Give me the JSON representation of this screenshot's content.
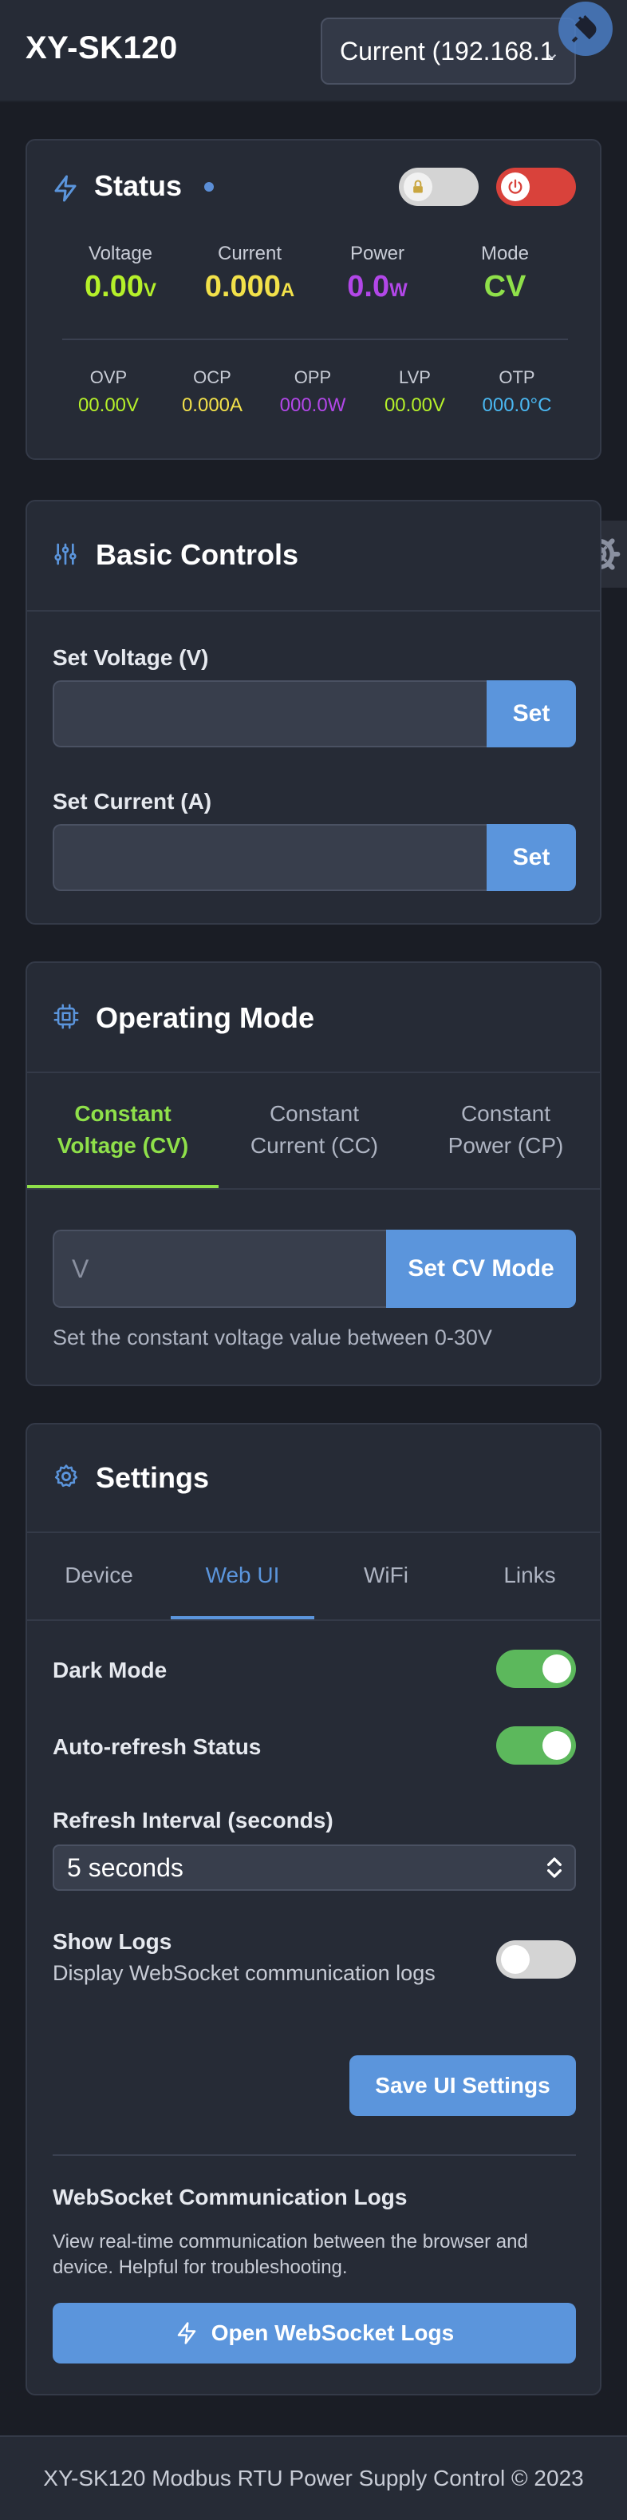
{
  "header": {
    "title": "XY-SK120",
    "device_select_value": "Current (192.168.1",
    "connect_icon": "plug-icon"
  },
  "status": {
    "title": "Status",
    "metrics": [
      {
        "label": "Voltage",
        "value": "0.00",
        "unit": "V",
        "color": "#b5f02a"
      },
      {
        "label": "Current",
        "value": "0.000",
        "unit": "A",
        "color": "#f2e14a"
      },
      {
        "label": "Power",
        "value": "0.0",
        "unit": "W",
        "color": "#b247e8"
      },
      {
        "label": "Mode",
        "value": "CV",
        "unit": "",
        "color": "#8fe04a"
      }
    ],
    "protections": [
      {
        "label": "OVP",
        "value": "00.00V",
        "color": "#b5f02a"
      },
      {
        "label": "OCP",
        "value": "0.000A",
        "color": "#f2e14a"
      },
      {
        "label": "OPP",
        "value": "000.0W",
        "color": "#b247e8"
      },
      {
        "label": "LVP",
        "value": "00.00V",
        "color": "#b5f02a"
      },
      {
        "label": "OTP",
        "value": "000.0°C",
        "color": "#4ab8f2"
      }
    ],
    "lock_toggle_on": false,
    "power_toggle_on": true
  },
  "basic_controls": {
    "title": "Basic Controls",
    "voltage_label": "Set Voltage (V)",
    "voltage_value": "",
    "voltage_button": "Set",
    "current_label": "Set Current (A)",
    "current_value": "",
    "current_button": "Set"
  },
  "operating_mode": {
    "title": "Operating Mode",
    "tabs": [
      {
        "label": "Constant Voltage (CV)",
        "active": true
      },
      {
        "label": "Constant Current (CC)",
        "active": false
      },
      {
        "label": "Constant Power (CP)",
        "active": false
      }
    ],
    "input_placeholder": "V",
    "button": "Set CV Mode",
    "help": "Set the constant voltage value between 0-30V"
  },
  "settings": {
    "title": "Settings",
    "tabs": [
      {
        "label": "Device",
        "active": false
      },
      {
        "label": "Web UI",
        "active": true
      },
      {
        "label": "WiFi",
        "active": false
      },
      {
        "label": "Links",
        "active": false
      }
    ],
    "dark_mode_label": "Dark Mode",
    "dark_mode_on": true,
    "auto_refresh_label": "Auto-refresh Status",
    "auto_refresh_on": true,
    "refresh_interval_label": "Refresh Interval (seconds)",
    "refresh_interval_value": "5 seconds",
    "show_logs_label": "Show Logs",
    "show_logs_sub": "Display WebSocket communication logs",
    "show_logs_on": false,
    "save_button": "Save UI Settings",
    "ws_logs_title": "WebSocket Communication Logs",
    "ws_logs_desc_line1": "View real-time communication between the browser and",
    "ws_logs_desc_line2": "device. Helpful for troubleshooting.",
    "open_logs_button": "Open WebSocket Logs",
    "accent": "#5b95dc"
  },
  "footer": {
    "text": "XY-SK120 Modbus RTU Power Supply Control © 2023"
  }
}
